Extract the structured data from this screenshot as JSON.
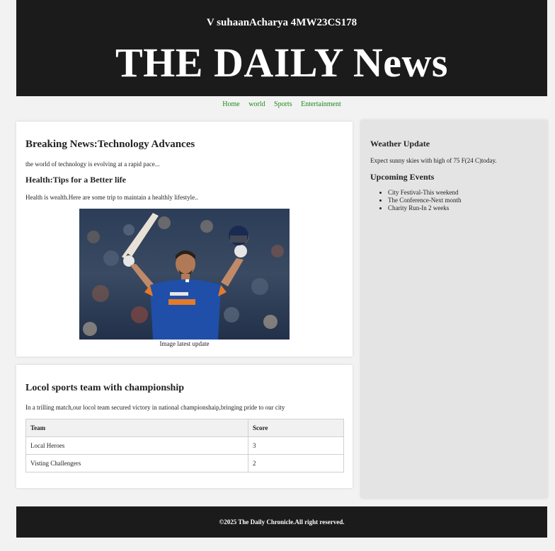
{
  "header": {
    "author": "V suhaanAcharya 4MW23CS178",
    "masthead": "THE DAILY News"
  },
  "nav": {
    "items": [
      {
        "label": "Home"
      },
      {
        "label": "world"
      },
      {
        "label": "Sports"
      },
      {
        "label": "Entertainment"
      }
    ],
    "link_color": "#1a8a1a"
  },
  "main": {
    "article1": {
      "title": "Breaking News:Technology Advances",
      "body": "the world of technology is evolving at a rapid pace..."
    },
    "article2": {
      "title": "Health:Tips for a Better life",
      "body": "Health is wealth.Here are some trip to maintain a healthly lifestyle.."
    },
    "image": {
      "icon": "cricketer-celebration-photo",
      "caption": "Image latest update"
    },
    "sports": {
      "title": "Locol sports team with championship",
      "body": "In a trilling match,our locol team secured victory in national championshaip,bringing pride to our city",
      "table": {
        "headers": [
          "Team",
          "Score"
        ],
        "rows": [
          [
            "Local Heroes",
            "3"
          ],
          [
            "Visting Challengers",
            "2"
          ]
        ]
      }
    }
  },
  "sidebar": {
    "weather": {
      "title": "Weather Update",
      "body": "Expect sunny skies with high of 75 F(24 C)today."
    },
    "events": {
      "title": "Upcoming Events",
      "items": [
        "City Festival-This weekend",
        "The Conference-Next month",
        "Charity Run-In 2 weeks"
      ]
    }
  },
  "footer": {
    "text": "©2025 The Daily Chronicle.All right reserved."
  },
  "colors": {
    "header_bg": "#1b1b1b",
    "page_bg": "#f2f2f2",
    "sidebar_bg": "#e4e4e4",
    "jersey_blue": "#1f4fa8"
  }
}
